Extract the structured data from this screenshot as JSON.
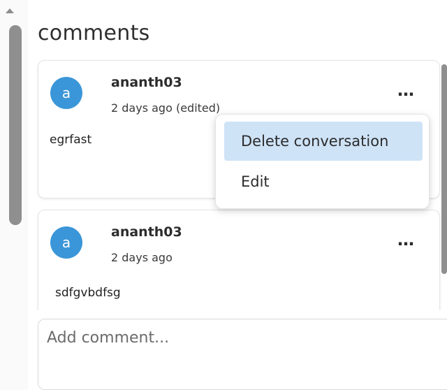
{
  "panel": {
    "title": "comments"
  },
  "comments": [
    {
      "avatar_letter": "a",
      "username": "ananth03",
      "timestamp": "2 days ago (edited)",
      "text": "egrfast",
      "more_icon": "⋯"
    },
    {
      "avatar_letter": "a",
      "username": "ananth03",
      "timestamp": "2 days ago",
      "text": "sdfgvbdfsg",
      "more_icon": "⋯"
    }
  ],
  "context_menu": {
    "items": [
      "Delete conversation",
      "Edit"
    ],
    "highlighted_index": 0
  },
  "composer": {
    "placeholder": "Add comment..."
  },
  "colors": {
    "avatar": "#3a96d8",
    "menu_highlight": "#cfe3f7",
    "scrollbar": "#8f8f8f"
  }
}
